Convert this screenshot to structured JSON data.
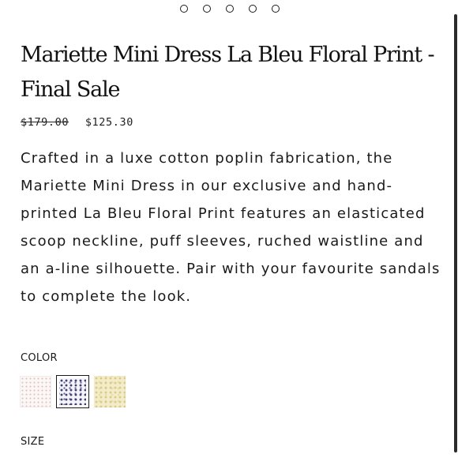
{
  "carousel": {
    "dots": [
      "slide-1",
      "slide-2",
      "slide-3",
      "slide-4",
      "slide-5"
    ]
  },
  "product": {
    "title": "Mariette Mini Dress La Bleu Floral Print - Final Sale",
    "price_original": "$179.00",
    "price_sale": "$125.30",
    "description": "Crafted in a luxe cotton poplin fabrication, the Mariette Mini Dress in our exclusive and hand-printed La Bleu Floral Print features an elasticated scoop neckline, puff sleeves, ruched waistline and an a-line silhouette. Pair with your favourite sandals to complete the look."
  },
  "color_section": {
    "label": "COLOR",
    "swatches": [
      {
        "name": "pink-floral",
        "selected": false,
        "color": "#fbf7f5"
      },
      {
        "name": "blue-floral",
        "selected": true,
        "color": "#3c3f7a"
      },
      {
        "name": "yellow-floral",
        "selected": false,
        "color": "#f3ecc9"
      }
    ]
  },
  "size_section": {
    "label": "SIZE"
  }
}
